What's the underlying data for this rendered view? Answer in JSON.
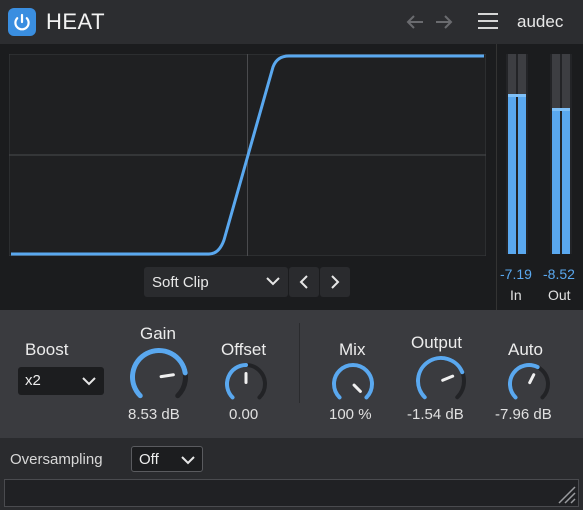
{
  "header": {
    "title": "HEAT",
    "brand": "audec"
  },
  "graph": {
    "preset": "Soft Clip"
  },
  "meters": {
    "in": {
      "value": "-7.19",
      "label": "In",
      "level": 0.79,
      "peak": 0.8
    },
    "out": {
      "value": "-8.52",
      "label": "Out",
      "level": 0.72,
      "peak": 0.73
    }
  },
  "controls": {
    "boost": {
      "label": "Boost",
      "value": "x2"
    },
    "gain": {
      "label": "Gain",
      "value": "8.53 dB",
      "position": 0.8
    },
    "offset": {
      "label": "Offset",
      "value": "0.00",
      "position": 0.5
    },
    "mix": {
      "label": "Mix",
      "value": "100 %",
      "position": 1.0
    },
    "output": {
      "label": "Output",
      "value": "-1.54 dB",
      "position": 0.75
    },
    "auto": {
      "label": "Auto",
      "value": "-7.96 dB",
      "position": 0.6
    }
  },
  "footer": {
    "oversampling_label": "Oversampling",
    "oversampling_value": "Off"
  },
  "colors": {
    "accent": "#5aa8ef",
    "power": "#3a8ee0"
  }
}
